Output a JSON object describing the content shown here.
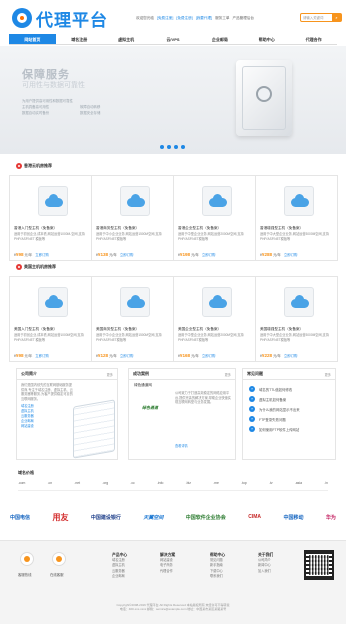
{
  "header": {
    "logo_text": "代理平台",
    "topbar": {
      "welcome": "欢迎您光临",
      "login": "[免费注册]",
      "reg": "[免费注册]",
      "agent": "[我要代理]",
      "service": "服务工单",
      "cert": "产品管理后台"
    },
    "search_placeholder": "请输入关键词"
  },
  "nav": {
    "items": [
      "网站首页",
      "域名注册",
      "虚拟主机",
      "云/VPS",
      "企业邮局",
      "帮助中心",
      "代理合作"
    ]
  },
  "banner": {
    "title": "保障服务",
    "subtitle": "可用性与数据可靠性",
    "features": [
      "为用户提供高可用性和数据可靠性",
      "主机具备高可用性",
      "数据自动实时备份",
      "故障自动转移",
      "数据安全存储"
    ]
  },
  "section1": {
    "title": "香港云机房推荐",
    "cards": [
      {
        "name": "香港入门型主机（免备案）",
        "desc": "适用于初创企业,成本低,网站运营1000M-空间,支持PHP/ASP.NET 模板等",
        "price": "¥98",
        "unit": "元/年",
        "buy": "立即订购"
      },
      {
        "name": "香港商务型主机（免备案）",
        "desc": "适用于中小企业业务,网站运营1500M空间,支持PHP/ASP.NET模板等",
        "price": "¥138",
        "unit": "元/年",
        "buy": "立即订购"
      },
      {
        "name": "香港企业型主机（免备案）",
        "desc": "适用于中型企业业务,网站运营2000M空间,支持PHP/ASP.NET模板等",
        "price": "¥198",
        "unit": "元/年",
        "buy": "立即订购"
      },
      {
        "name": "香港增强型主机（免备案）",
        "desc": "适用于中大型企业业务,网站运营3000M空间,支持PHP/ASP.NET模板等",
        "price": "¥288",
        "unit": "元/年",
        "buy": "立即订购"
      }
    ]
  },
  "section2": {
    "title": "美国主机机房推荐",
    "cards": [
      {
        "name": "美国入门型主机（免备案）",
        "desc": "适用于初创企业,成本低,网站运营1000M空间,支持PHP/ASP.NET 模板等",
        "price": "¥98",
        "unit": "元/年",
        "buy": "立即订购"
      },
      {
        "name": "美国商务型主机（免备案）",
        "desc": "适用于中小企业业务,网站运营1500M空间,支持PHP/ASP.NET模板等",
        "price": "¥128",
        "unit": "元/年",
        "buy": "立即订购"
      },
      {
        "name": "美国企业型主机（免备案）",
        "desc": "适用于中型企业业务,网站运营2000M空间,支持PHP/ASP.NET模板等",
        "price": "¥168",
        "unit": "元/年",
        "buy": "立即订购"
      },
      {
        "name": "美国增强型主机（免备案）",
        "desc": "适用于中大型企业业务,网站运营3000M空间,支持PHP/ASP.NET模板等",
        "price": "¥228",
        "unit": "元/年",
        "buy": "立即订购"
      }
    ]
  },
  "panels": {
    "intro": {
      "title": "公司简介",
      "more": "更多",
      "text": "我们是国内领先的互联网基础服务提供商,专注于域名注册、虚拟主机、云服务器等服务,为客户提供稳定可靠的互联网服务。",
      "links": [
        "域名注册",
        "虚拟主机",
        "云服务器",
        "企业邮局",
        "网站建设"
      ]
    },
    "cases": {
      "title": "成功案例",
      "more": "更多",
      "case_name": "绿色通道网",
      "case_logo": "绿色通道",
      "text": "公司致力于打造高效稳定的网络应用平台,提供完善的解决方案,帮助企业快速实现互联网转型与业务发展。",
      "detail": "查看详情"
    },
    "faq": {
      "title": "常见问题",
      "more": "更多",
      "items": [
        "域名的TTL值如何修改",
        "虚拟主机如何备案",
        "为什么我的网站显示不出来",
        "FTP登录失败问题",
        "如何使用FTP软件上传网站"
      ]
    }
  },
  "domains": {
    "label": "域名价格",
    "items": [
      ".com",
      ".cn",
      ".net",
      ".org",
      ".cc",
      ".info",
      ".biz",
      ".me",
      ".top",
      ".tv",
      ".asia",
      ".in"
    ]
  },
  "partners": [
    "中国电信",
    "用友",
    "中国建设银行",
    "天翼空间",
    "中国软件企业协会",
    "CIMA",
    "中国移动",
    "华为"
  ],
  "footer": {
    "c1_label": "客服热线",
    "c2_label": "在线客服",
    "cols": [
      {
        "title": "产品中心",
        "items": [
          "域名注册",
          "虚拟主机",
          "云服务器",
          "企业邮局"
        ]
      },
      {
        "title": "解决方案",
        "items": [
          "网站建设",
          "电子商务",
          "代理合作"
        ]
      },
      {
        "title": "帮助中心",
        "items": [
          "常见问题",
          "新手指南",
          "下载中心",
          "联系我们"
        ]
      },
      {
        "title": "关于我们",
        "items": [
          "公司简介",
          "新闻中心",
          "加入我们"
        ]
      }
    ],
    "copyright": "Copyright©2008-2016 代理平台 All Rights Reserved 本站版权所有 未经许可不得转载",
    "contact": "电话：400-xxx-xxxx  邮箱：service@example.com  地址：中国某市某区某路某号"
  }
}
